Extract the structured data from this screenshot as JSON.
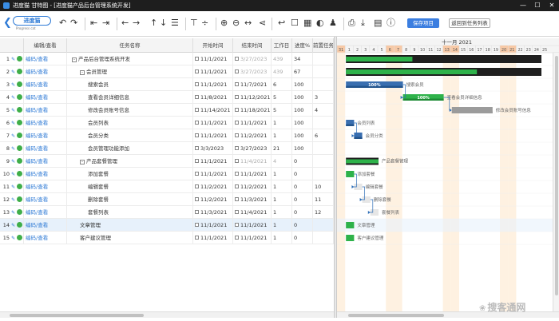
{
  "window": {
    "title": "进度猫 甘特图 - [进度猫产品后台管理系统开发]",
    "minimize": "—",
    "maximize": "☐",
    "close": "✕"
  },
  "logo": {
    "name": "进度猫",
    "subtitle": "Progress cat"
  },
  "toolbar": {
    "save_label": "保存项目",
    "back_label": "返回到任务列表"
  },
  "grid": {
    "columns": [
      "编辑/查看",
      "任务名称",
      "开始时间",
      "结束时间",
      "工作日",
      "进度%",
      "前置任务"
    ],
    "rows": [
      {
        "num": "1",
        "edit": "编码/查看",
        "name": "产品后台管理系统开发",
        "level": 0,
        "toggle": "-",
        "start": "11/1/2021",
        "end": "3/27/2023",
        "days": "439",
        "progress": "34",
        "pred": "",
        "muted": true
      },
      {
        "num": "2",
        "edit": "编码/查看",
        "name": "会员管理",
        "level": 1,
        "toggle": "-",
        "start": "11/1/2021",
        "end": "3/27/2023",
        "days": "439",
        "progress": "67",
        "pred": "",
        "muted": true
      },
      {
        "num": "3",
        "edit": "编码/查看",
        "name": "搜索会员",
        "level": 2,
        "toggle": "",
        "start": "11/1/2021",
        "end": "11/7/2021",
        "days": "6",
        "progress": "100",
        "pred": "",
        "muted": false
      },
      {
        "num": "4",
        "edit": "编码/查看",
        "name": "查看会员详细信息",
        "level": 2,
        "toggle": "",
        "start": "11/8/2021",
        "end": "11/12/2021",
        "days": "5",
        "progress": "100",
        "pred": "3",
        "muted": false
      },
      {
        "num": "5",
        "edit": "编码/查看",
        "name": "修改会员账号信息",
        "level": 2,
        "toggle": "",
        "start": "11/14/2021",
        "end": "11/18/2021",
        "days": "5",
        "progress": "100",
        "pred": "4",
        "muted": false
      },
      {
        "num": "6",
        "edit": "编码/查看",
        "name": "会员列表",
        "level": 2,
        "toggle": "",
        "start": "11/1/2021",
        "end": "11/1/2021",
        "days": "1",
        "progress": "100",
        "pred": "",
        "muted": false
      },
      {
        "num": "7",
        "edit": "编码/查看",
        "name": "会员分类",
        "level": 2,
        "toggle": "",
        "start": "11/1/2021",
        "end": "11/2/2021",
        "days": "1",
        "progress": "100",
        "pred": "6",
        "muted": false
      },
      {
        "num": "8",
        "edit": "编码/查看",
        "name": "会员管理功能添加",
        "level": 2,
        "toggle": "",
        "start": "3/3/2023",
        "end": "3/27/2023",
        "days": "21",
        "progress": "100",
        "pred": "",
        "muted": false
      },
      {
        "num": "9",
        "edit": "编码/查看",
        "name": "产品套餐管理",
        "level": 1,
        "toggle": "-",
        "start": "11/1/2021",
        "end": "11/4/2021",
        "days": "4",
        "progress": "0",
        "pred": "",
        "muted": true
      },
      {
        "num": "10",
        "edit": "编码/查看",
        "name": "添加套餐",
        "level": 2,
        "toggle": "",
        "start": "11/1/2021",
        "end": "11/1/2021",
        "days": "1",
        "progress": "0",
        "pred": "",
        "muted": false
      },
      {
        "num": "11",
        "edit": "编码/查看",
        "name": "编辑套餐",
        "level": 2,
        "toggle": "",
        "start": "11/2/2021",
        "end": "11/2/2021",
        "days": "1",
        "progress": "0",
        "pred": "10",
        "muted": false
      },
      {
        "num": "12",
        "edit": "编码/查看",
        "name": "删除套餐",
        "level": 2,
        "toggle": "",
        "start": "11/2/2021",
        "end": "11/3/2021",
        "days": "1",
        "progress": "0",
        "pred": "11",
        "muted": false
      },
      {
        "num": "13",
        "edit": "编码/查看",
        "name": "套餐列表",
        "level": 2,
        "toggle": "",
        "start": "11/3/2021",
        "end": "11/4/2021",
        "days": "1",
        "progress": "0",
        "pred": "12",
        "muted": false
      },
      {
        "num": "14",
        "edit": "编码/查看",
        "name": "文章管理",
        "level": 1,
        "toggle": "",
        "start": "11/1/2021",
        "end": "11/1/2021",
        "days": "1",
        "progress": "0",
        "pred": "",
        "muted": false
      },
      {
        "num": "15",
        "edit": "编码/查看",
        "name": "客户建议管理",
        "level": 1,
        "toggle": "",
        "start": "11/1/2021",
        "end": "11/1/2021",
        "days": "1",
        "progress": "0",
        "pred": "",
        "muted": false
      }
    ]
  },
  "gantt": {
    "month_label": "十一月 2021",
    "days": [
      "31",
      "1",
      "2",
      "3",
      "4",
      "5",
      "6",
      "7",
      "8",
      "9",
      "10",
      "11",
      "12",
      "13",
      "14",
      "15",
      "16",
      "17",
      "18",
      "19",
      "20",
      "21",
      "22",
      "23",
      "24",
      "25"
    ],
    "weekend_indices": [
      0,
      6,
      7,
      13,
      14,
      20,
      21
    ],
    "colors": {
      "summary": "#1f1f1f",
      "summary_fill": "#2eb24a",
      "task_done": "#3a6fb0",
      "task_done_dark": "#22548d",
      "green": "#2eb24a",
      "green_dark": "#1c8a34",
      "gray": "#9b9b9b",
      "weekend": "#fde6c9",
      "today": "#f7c9a6"
    },
    "bars": [
      {
        "row": 0,
        "start": 1,
        "dur": 24,
        "progress": 34,
        "kind": "summary",
        "label": ""
      },
      {
        "row": 1,
        "start": 1,
        "dur": 24,
        "progress": 67,
        "kind": "summary",
        "label": ""
      },
      {
        "row": 2,
        "start": 1,
        "dur": 7,
        "progress": 100,
        "kind": "blue",
        "label": "搜索会员",
        "pct": "100%"
      },
      {
        "row": 3,
        "start": 8,
        "dur": 5,
        "progress": 100,
        "kind": "green",
        "label": "查看会员详细信息",
        "pct": "100%"
      },
      {
        "row": 4,
        "start": 14,
        "dur": 5,
        "progress": 100,
        "kind": "gray",
        "label": "修改会员账号信息",
        "pct": ""
      },
      {
        "row": 5,
        "start": 1,
        "dur": 1,
        "progress": 100,
        "kind": "blue",
        "label": "会员列表",
        "pct": ""
      },
      {
        "row": 6,
        "start": 2,
        "dur": 1,
        "progress": 100,
        "kind": "blue",
        "label": "会员分类",
        "pct": ""
      },
      {
        "row": 8,
        "start": 1,
        "dur": 4,
        "progress": 0,
        "kind": "green-summary",
        "label": "产品套餐管理",
        "pct": ""
      },
      {
        "row": 9,
        "start": 1,
        "dur": 1,
        "progress": 0,
        "kind": "green",
        "label": "添加套餐",
        "pct": ""
      },
      {
        "row": 10,
        "start": 2,
        "dur": 1,
        "progress": 0,
        "kind": "light",
        "label": "编辑套餐",
        "pct": ""
      },
      {
        "row": 11,
        "start": 3,
        "dur": 1,
        "progress": 0,
        "kind": "light",
        "label": "删除套餐",
        "pct": ""
      },
      {
        "row": 12,
        "start": 4,
        "dur": 1,
        "progress": 0,
        "kind": "light",
        "label": "套餐列表",
        "pct": ""
      },
      {
        "row": 13,
        "start": 1,
        "dur": 1,
        "progress": 0,
        "kind": "green",
        "label": "文章管理",
        "pct": ""
      },
      {
        "row": 14,
        "start": 1,
        "dur": 1,
        "progress": 0,
        "kind": "green",
        "label": "客户建议管理",
        "pct": ""
      }
    ],
    "links": [
      [
        2,
        3
      ],
      [
        3,
        4
      ],
      [
        5,
        6
      ],
      [
        9,
        10
      ],
      [
        10,
        11
      ],
      [
        11,
        12
      ]
    ]
  },
  "watermark": {
    "text": "搜客通网"
  }
}
